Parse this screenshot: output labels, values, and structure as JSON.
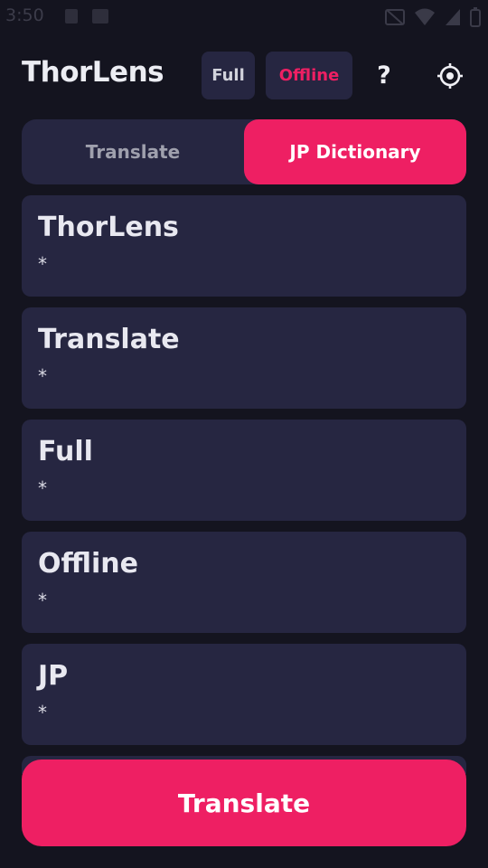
{
  "status_bar": {
    "time": "3:50"
  },
  "header": {
    "app_title": "ThorLens",
    "chip_full": "Full",
    "chip_offline": "Offline",
    "help_label": "?",
    "settings_icon": "gear-icon"
  },
  "mode_toggle": {
    "tabs": [
      {
        "label": "Translate",
        "selected": false
      },
      {
        "label": "JP Dictionary",
        "selected": true
      }
    ]
  },
  "cards": [
    {
      "title": "ThorLens",
      "subtitle": "*"
    },
    {
      "title": "Translate",
      "subtitle": "*"
    },
    {
      "title": "Full",
      "subtitle": "*"
    },
    {
      "title": "Offline",
      "subtitle": "*"
    },
    {
      "title": "JP",
      "subtitle": "*"
    }
  ],
  "primary_action": {
    "label": "Translate"
  },
  "colors": {
    "background": "#14141f",
    "surface": "#262641",
    "accent": "#ee1f63",
    "text": "#e8e8f0"
  }
}
